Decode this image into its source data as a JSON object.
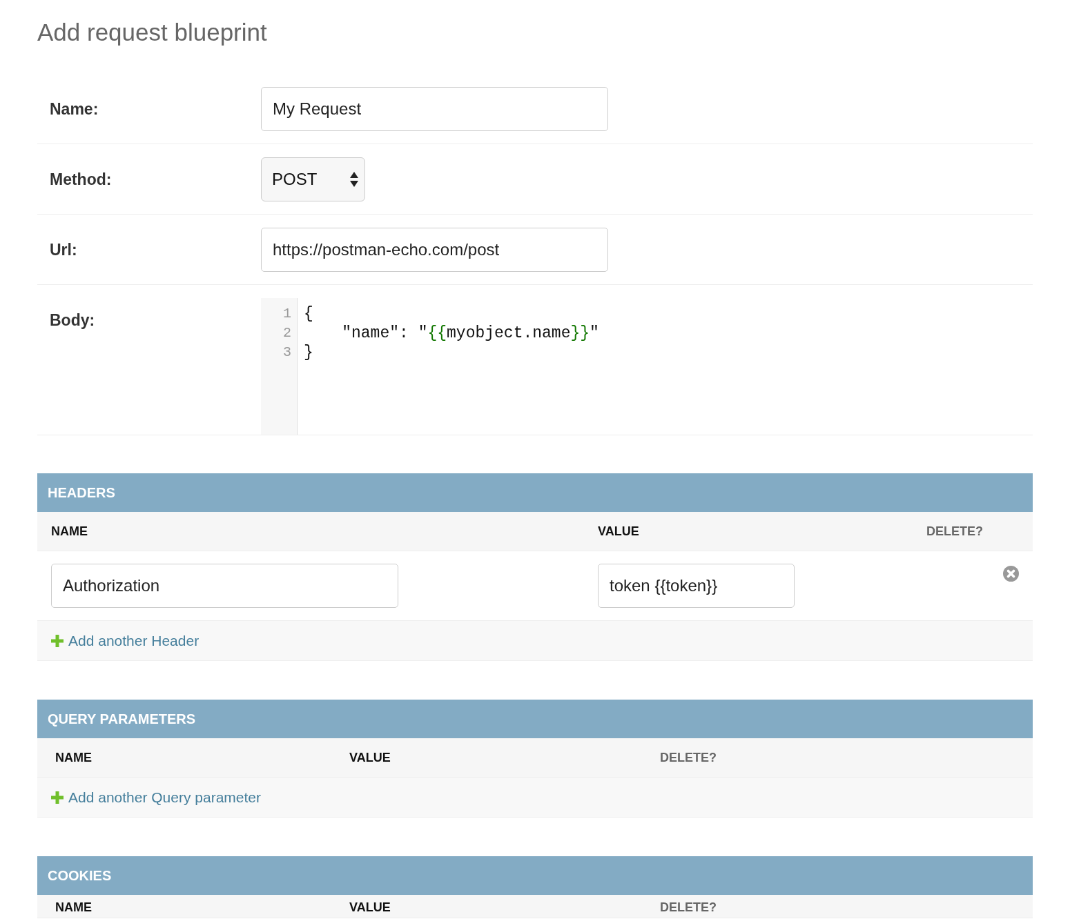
{
  "page": {
    "title": "Add request blueprint"
  },
  "form": {
    "fields": [
      {
        "kind": "text",
        "label": "Name:",
        "value": "My Request"
      },
      {
        "kind": "select",
        "label": "Method:",
        "value": "POST"
      },
      {
        "kind": "text",
        "label": "Url:",
        "value": "https://postman-echo.com/post"
      },
      {
        "kind": "code",
        "label": "Body:",
        "lines": [
          {
            "number": "1",
            "tokens": [
              {
                "kind": "plain",
                "text": "{"
              }
            ]
          },
          {
            "number": "2",
            "tokens": [
              {
                "kind": "plain",
                "text": "    \"name\": \""
              },
              {
                "kind": "template",
                "text": "{{"
              },
              {
                "kind": "plain",
                "text": "myobject.name"
              },
              {
                "kind": "template",
                "text": "}}"
              },
              {
                "kind": "plain",
                "text": "\""
              }
            ]
          },
          {
            "number": "3",
            "tokens": [
              {
                "kind": "plain",
                "text": "}"
              }
            ]
          }
        ]
      }
    ]
  },
  "sections": [
    {
      "title": "HEADERS",
      "columns": [
        {
          "kind": "field",
          "label": "NAME"
        },
        {
          "kind": "field",
          "label": "VALUE"
        },
        {
          "kind": "action",
          "label": "DELETE?"
        }
      ],
      "rows": [
        {
          "name": "Authorization",
          "value": "token {{token}}"
        }
      ],
      "add_link": "Add another Header"
    },
    {
      "title": "QUERY PARAMETERS",
      "columns": [
        {
          "kind": "field",
          "label": "NAME"
        },
        {
          "kind": "field",
          "label": "VALUE"
        },
        {
          "kind": "action",
          "label": "DELETE?"
        }
      ],
      "add_link": "Add another Query parameter"
    },
    {
      "title": "COOKIES",
      "columns": [
        {
          "kind": "field",
          "label": "NAME"
        },
        {
          "kind": "field",
          "label": "VALUE"
        },
        {
          "kind": "action",
          "label": "DELETE?"
        }
      ]
    }
  ]
}
